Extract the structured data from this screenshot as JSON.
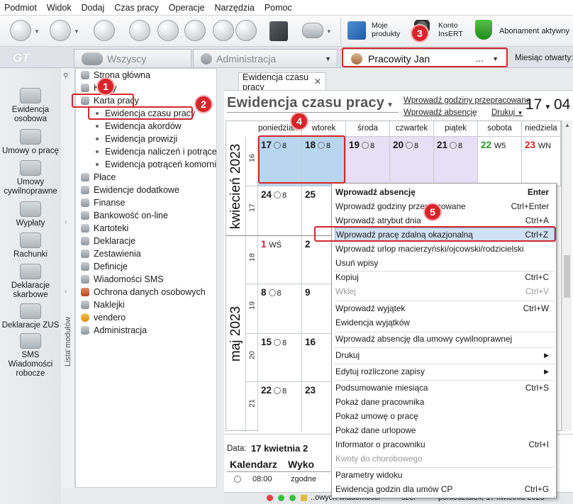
{
  "menu": [
    "Podmiot",
    "Widok",
    "Dodaj",
    "Czas pracy",
    "Operacje",
    "Narzędzia",
    "Pomoc"
  ],
  "toolbar": {
    "moje_produkty": "Moje\nprodukty",
    "konto_insert": "Konto\nInsERT",
    "abonament": "Abonament aktywny"
  },
  "tabs": {
    "wszyscy": "Wszyscy",
    "administracja": "Administracja",
    "employee": "Pracowity Jan",
    "employee_dots": "...",
    "miesiac_label": "Miesiąc otwarty:"
  },
  "leftbar": [
    "Ewidencja\nosobowa",
    "Umowy o pracę",
    "Umowy\ncywilnoprawne",
    "Wypłaty",
    "Rachunki",
    "Deklaracje\nskarbowe",
    "Deklaracje ZUS",
    "SMS\nWiadomości\nrobocze"
  ],
  "vstrip_label": "Lista modułów",
  "tree": {
    "items": [
      "Strona główna",
      "Kadry",
      "Karta pracy",
      "Ewidencja czasu pracy",
      "Ewidencja akordów",
      "Ewidencja prowizji",
      "Ewidencja naliczeń i potrąceń",
      "Ewidencja potrąceń komorniczych",
      "Płace",
      "Ewidencje dodatkowe",
      "Finanse",
      "Bankowość on-line",
      "Kartoteki",
      "Deklaracje",
      "Zestawienia",
      "Definicje",
      "Wiadomości SMS",
      "Ochrona danych osobowych",
      "Naklejki",
      "vendero",
      "Administracja"
    ]
  },
  "doc": {
    "tab_label": "Ewidencja czasu pracy",
    "title": "Ewidencja czasu pracy",
    "link_godziny": "Wprowadź godziny przepracowane",
    "link_absencje": "Wprowadź absencję",
    "drukuj": "Drukuj",
    "day": "17",
    "month": "04"
  },
  "calendar": {
    "weekdays": [
      "poniedziałek",
      "wtorek",
      "środa",
      "czwartek",
      "piątek",
      "sobota",
      "niedziela"
    ],
    "months": [
      "kwiecień 2023",
      "maj 2023"
    ],
    "weeks": [
      "16",
      "17",
      "18",
      "19",
      "20",
      "21"
    ],
    "row16": {
      "d1": "17",
      "d2": "18",
      "d3": "19",
      "d4": "20",
      "d5": "21",
      "d6": "22",
      "d7": "23",
      "h": "8",
      "w5": "W5",
      "wn": "WN"
    },
    "row17": {
      "d1": "24",
      "d2": "25",
      "h": "8"
    },
    "row18": {
      "d1": "1",
      "ws": "WŚ",
      "d2": "2"
    },
    "row19": {
      "d1": "8",
      "d2": "9",
      "h": "8"
    },
    "row20": {
      "d1": "15",
      "d2": "16",
      "h": "8"
    },
    "row21": {
      "d1": "22",
      "d2": "23",
      "h": "8"
    }
  },
  "bottom": {
    "data_label": "Data:",
    "data_value": "17 kwietnia 2",
    "kalendarz": "Kalendarz",
    "wyko": "Wyko",
    "time": "08:00",
    "zgodne": "zgodne"
  },
  "status": {
    "text1": "..owych wiadomości",
    "text2": "szer",
    "text3": "poniedziałek, 17 kwietnia 2023"
  },
  "context_menu": [
    {
      "label": "Wprowadź absencję",
      "shortcut": "Enter",
      "bold": true
    },
    {
      "label": "Wprowadź godziny przepracowane",
      "shortcut": "Ctrl+Enter"
    },
    {
      "label": "Wprowadź atrybut dnia",
      "shortcut": "Ctrl+A"
    },
    {
      "label": "Wprowadź pracę zdalną okazjonalną",
      "shortcut": "Ctrl+Z",
      "highlight": true
    },
    {
      "label": "Wprowadź urlop macierzyński/ojcowski/rodzicielski",
      "shortcut": ""
    },
    {
      "label": "Usuń wpisy",
      "shortcut": ""
    },
    {
      "label": "Kopiuj",
      "shortcut": "Ctrl+C"
    },
    {
      "label": "Wklej",
      "shortcut": "Ctrl+V",
      "disabled": true
    },
    {
      "label": "Wprowadź wyjątek",
      "shortcut": "Ctrl+W"
    },
    {
      "label": "Ewidencja wyjątków",
      "shortcut": ""
    },
    {
      "label": "Wprowadź absencję dla umowy cywilnoprawnej",
      "shortcut": ""
    },
    {
      "label": "Drukuj",
      "shortcut": "▶"
    },
    {
      "label": "Edytuj rozliczone zapisy",
      "shortcut": "▶"
    },
    {
      "label": "Podsumowanie miesiąca",
      "shortcut": "Ctrl+S"
    },
    {
      "label": "Pokaż dane pracownika",
      "shortcut": ""
    },
    {
      "label": "Pokaż umowę o pracę",
      "shortcut": ""
    },
    {
      "label": "Pokaż dane urlopowe",
      "shortcut": ""
    },
    {
      "label": "Informator o pracowniku",
      "shortcut": "Ctrl+I"
    },
    {
      "label": "Kwoty do chorobowego",
      "shortcut": "",
      "disabled": true
    },
    {
      "label": "Parametry widoku",
      "shortcut": ""
    },
    {
      "label": "Ewidencja godzin dla umów CP",
      "shortcut": "Ctrl+G"
    }
  ],
  "annotations": [
    "1",
    "2",
    "3",
    "4",
    "5"
  ]
}
